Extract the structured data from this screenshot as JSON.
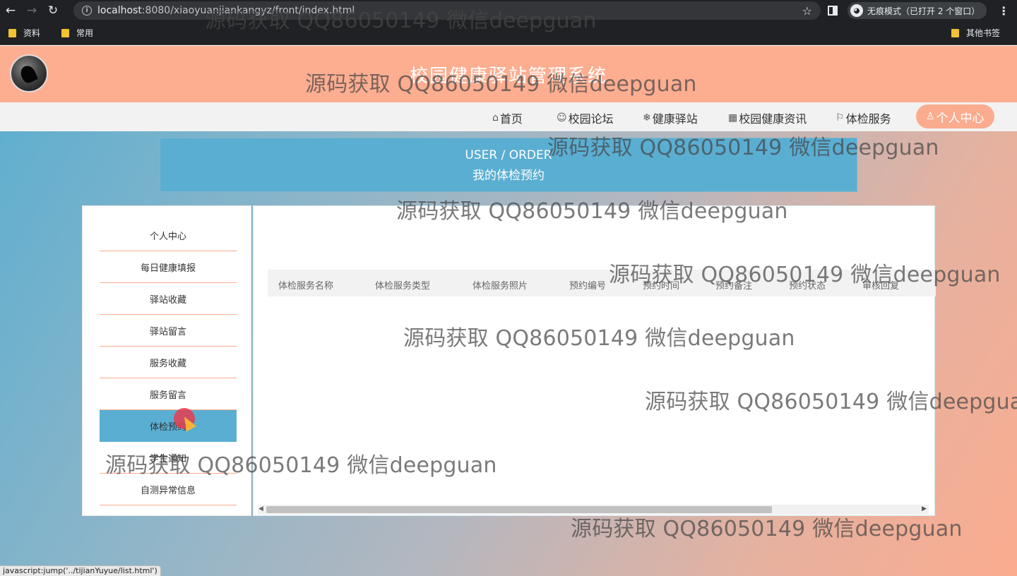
{
  "browser": {
    "url_host": "localhost",
    "url_rest": ":8080/xiaoyuanjiankangyz/front/index.html",
    "incognito_label": "无痕模式（已打开 2 个窗口）",
    "bookmarks": [
      "资料",
      "常用"
    ],
    "bookmarks_other": "其他书签",
    "status_url": "javascript:jump('../tijianYuyue/list.html')"
  },
  "site": {
    "title": "校园健康驿站管理系统"
  },
  "nav": {
    "items": [
      {
        "icon": "⌂",
        "label": "首页"
      },
      {
        "icon": "☺",
        "label": "校园论坛"
      },
      {
        "icon": "❄",
        "label": "健康驿站"
      },
      {
        "icon": "▦",
        "label": "校园健康资讯"
      },
      {
        "icon": "⚐",
        "label": "体检服务"
      }
    ],
    "active": {
      "icon": "♙",
      "label": "个人中心"
    }
  },
  "banner": {
    "en": "USER / ORDER",
    "zh": "我的体检预约"
  },
  "sidebar": {
    "items": [
      "个人中心",
      "每日健康填报",
      "驿站收藏",
      "驿站留言",
      "服务收藏",
      "服务留言",
      "体检预约",
      "学生通知",
      "自测异常信息"
    ],
    "active_index": 6
  },
  "table": {
    "columns": [
      "体检服务名称",
      "体检服务类型",
      "体检服务照片",
      "预约编号",
      "预约时间",
      "预约备注",
      "预约状态",
      "审核回复"
    ]
  },
  "watermark": "源码获取 QQ86050149 微信deepguan"
}
